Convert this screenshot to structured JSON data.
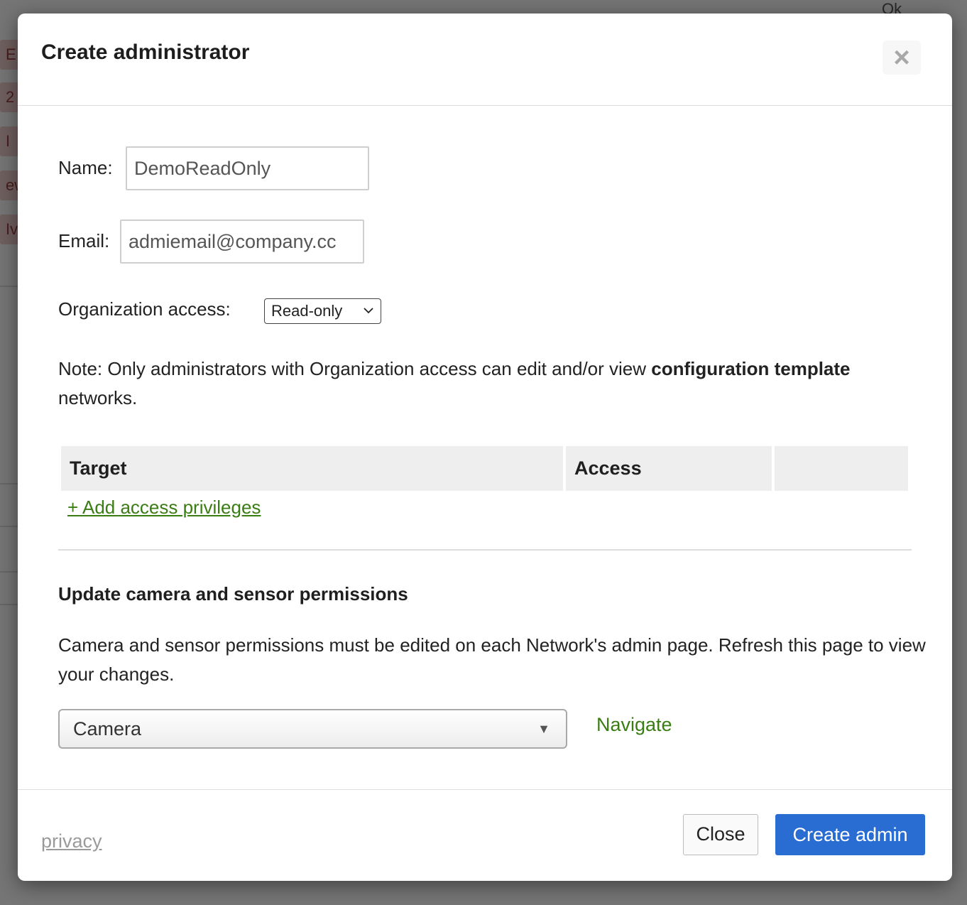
{
  "background": {
    "ok_text": "Ok",
    "tags": [
      "E",
      "2",
      "I",
      "ew",
      "Iv"
    ]
  },
  "modal": {
    "title": "Create administrator",
    "close_icon": "close-icon"
  },
  "form": {
    "name_label": "Name:",
    "name_value": "DemoReadOnly",
    "email_label": "Email:",
    "email_value": "admiemail@company.cc",
    "org_access_label": "Organization access:",
    "org_access_selected": "Read-only"
  },
  "note": {
    "prefix": "Note: Only administrators with Organization access can edit and/or view ",
    "bold": "configuration template",
    "suffix": " networks."
  },
  "privileges_table": {
    "columns": [
      "Target",
      "Access",
      ""
    ],
    "add_link": "+ Add access privileges"
  },
  "camera_section": {
    "title": "Update camera and sensor permissions",
    "text": "Camera and sensor permissions must be edited on each Network's admin page. Refresh this page to view your changes.",
    "select_value": "Camera",
    "navigate_label": "Navigate"
  },
  "footer": {
    "privacy_label": "privacy",
    "close_label": "Close",
    "create_label": "Create admin"
  },
  "colors": {
    "primary_button": "#2a6dd2",
    "link_green": "#3a7d13"
  }
}
